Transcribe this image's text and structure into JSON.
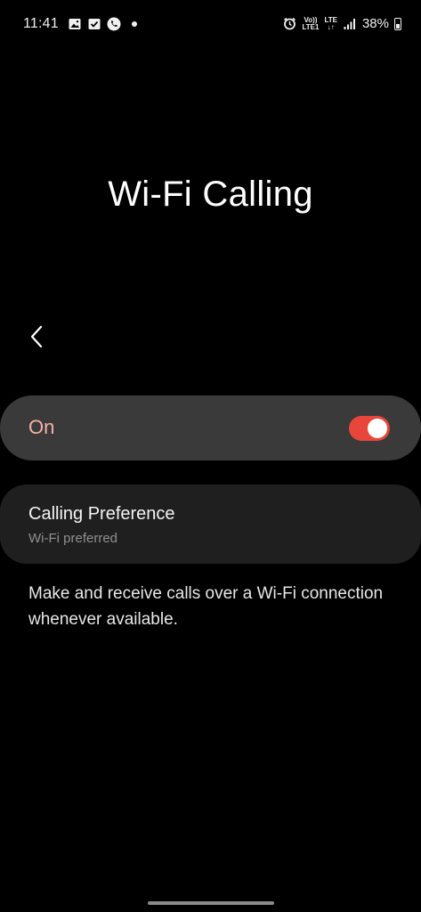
{
  "status_bar": {
    "time": "11:41",
    "volte_top": "Vo))",
    "volte_bottom": "LTE1",
    "lte_top": "LTE",
    "lte_bottom": "↓↑",
    "battery": "38%"
  },
  "page": {
    "title": "Wi-Fi Calling"
  },
  "toggle": {
    "label": "On",
    "state": true,
    "accent": "#e8463a",
    "label_color": "#f3b1a6"
  },
  "preference": {
    "title": "Calling Preference",
    "value": "Wi-Fi preferred"
  },
  "description": "Make and receive calls over a Wi-Fi connection whenever available.",
  "icons": {
    "back": "chevron-left-icon",
    "status_left": [
      "gallery-icon",
      "task-check-icon",
      "phone-call-icon",
      "notification-dot"
    ],
    "status_right": [
      "alarm-icon",
      "volte-icon",
      "lte-icon",
      "signal-icon",
      "battery-icon"
    ]
  }
}
